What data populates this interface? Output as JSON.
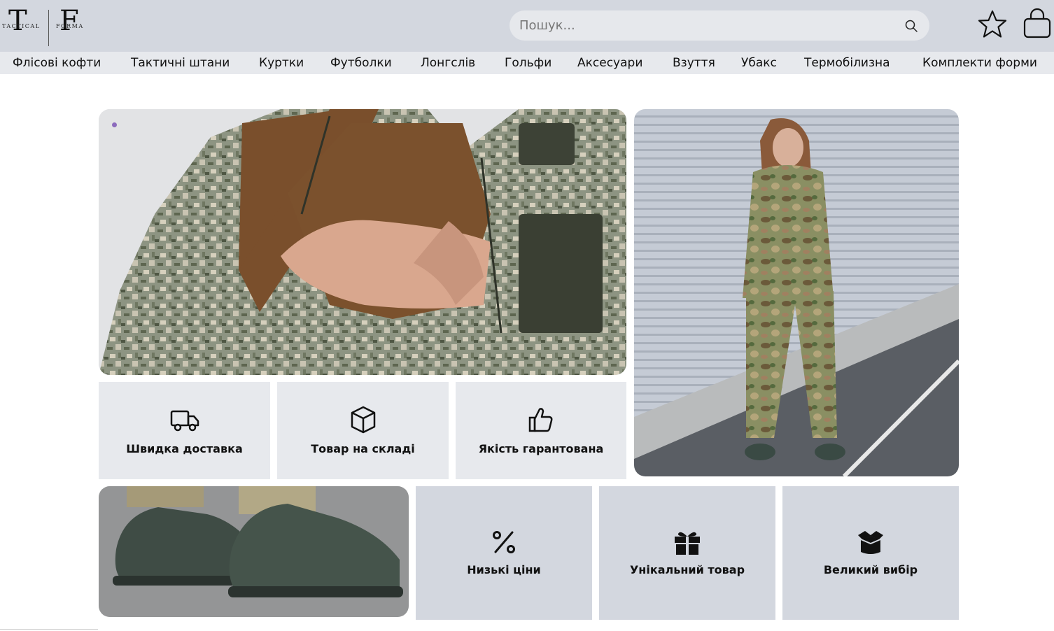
{
  "brand": {
    "letter_left": "T",
    "letter_right": "F",
    "sub_left": "TACTICAL",
    "sub_right": "FORMA"
  },
  "search": {
    "placeholder": "Пошук..."
  },
  "nav": {
    "items": [
      "Флісові кофти",
      "Тактичні штани",
      "Куртки",
      "Футболки",
      "Лонгслів",
      "Гольфи",
      "Аксесуари",
      "Взуття",
      "Убакс",
      "Термобілизна",
      "Комплекти форми"
    ]
  },
  "features": {
    "delivery": "Швидка доставка",
    "stock": "Товар на складі",
    "quality": "Якість гарантована",
    "prices": "Низькі ціни",
    "unique": "Унікальний товар",
    "choice": "Великий вибір"
  },
  "icons": {
    "search": "search-icon",
    "favorites": "star-icon",
    "cart": "shopping-bag-icon",
    "delivery": "truck-icon",
    "stock": "box-icon",
    "quality": "thumbs-up-icon",
    "prices": "percent-icon",
    "unique": "gift-icon",
    "choice": "open-box-icon"
  },
  "colors": {
    "header_bg": "#d3d7df",
    "nav_bg": "#e7e9ed",
    "slider_dot": "#8c6bbd"
  }
}
